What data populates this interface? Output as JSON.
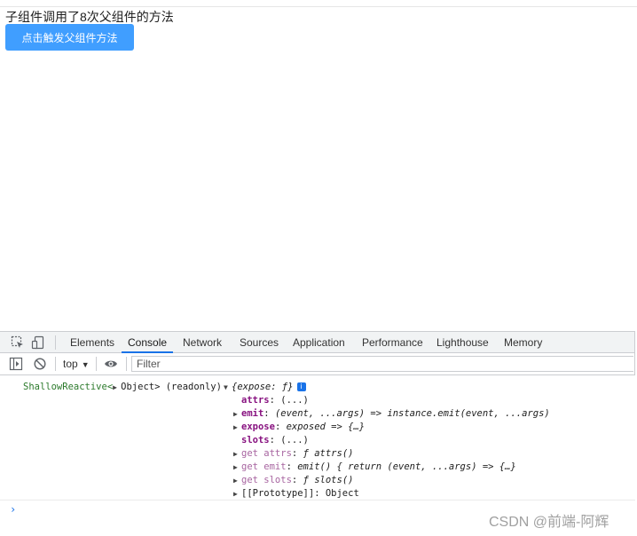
{
  "app": {
    "message": "子组件调用了8次父组件的方法",
    "button_label": "点击触发父组件方法",
    "button_color": "#409eff"
  },
  "devtools": {
    "tabs": [
      {
        "label": "Elements",
        "active": false
      },
      {
        "label": "Console",
        "active": true
      },
      {
        "label": "Network",
        "active": false
      },
      {
        "label": "Sources",
        "active": false
      },
      {
        "label": "Application",
        "active": false
      },
      {
        "label": "Performance",
        "active": false
      },
      {
        "label": "Lighthouse",
        "active": false
      },
      {
        "label": "Memory",
        "active": false
      }
    ],
    "toolbar_icons": [
      "inspect-element-icon",
      "device-toggle-icon",
      "sidebar-toggle-icon",
      "clear-console-icon",
      "eye-icon"
    ],
    "context": "top",
    "filter_placeholder": "Filter",
    "accent_color": "#1a73e8"
  },
  "console": {
    "head": {
      "type": "ShallowReactive<",
      "object": "Object> (readonly)",
      "preview": "{expose: ƒ}",
      "badge": "i"
    },
    "props": [
      {
        "key": "attrs",
        "value": "(...)",
        "expandable": false,
        "getter": false,
        "italic": false
      },
      {
        "key": "emit",
        "value": "(event, ...args) => instance.emit(event, ...args)",
        "expandable": true,
        "getter": false,
        "italic": true
      },
      {
        "key": "expose",
        "value": "exposed => {…}",
        "expandable": true,
        "getter": false,
        "italic": true
      },
      {
        "key": "slots",
        "value": "(...)",
        "expandable": false,
        "getter": false,
        "italic": false
      },
      {
        "key": "get attrs",
        "value": "ƒ attrs()",
        "expandable": true,
        "getter": true,
        "italic": true
      },
      {
        "key": "get emit",
        "value": "emit() { return (event, ...args) => {…}",
        "expandable": true,
        "getter": true,
        "italic": true
      },
      {
        "key": "get slots",
        "value": "ƒ slots()",
        "expandable": true,
        "getter": true,
        "italic": true
      },
      {
        "key": "[[Prototype]]",
        "value": "Object",
        "expandable": true,
        "getter": false,
        "italic": false
      }
    ],
    "prompt": "›"
  },
  "watermark": "CSDN @前端-阿辉"
}
